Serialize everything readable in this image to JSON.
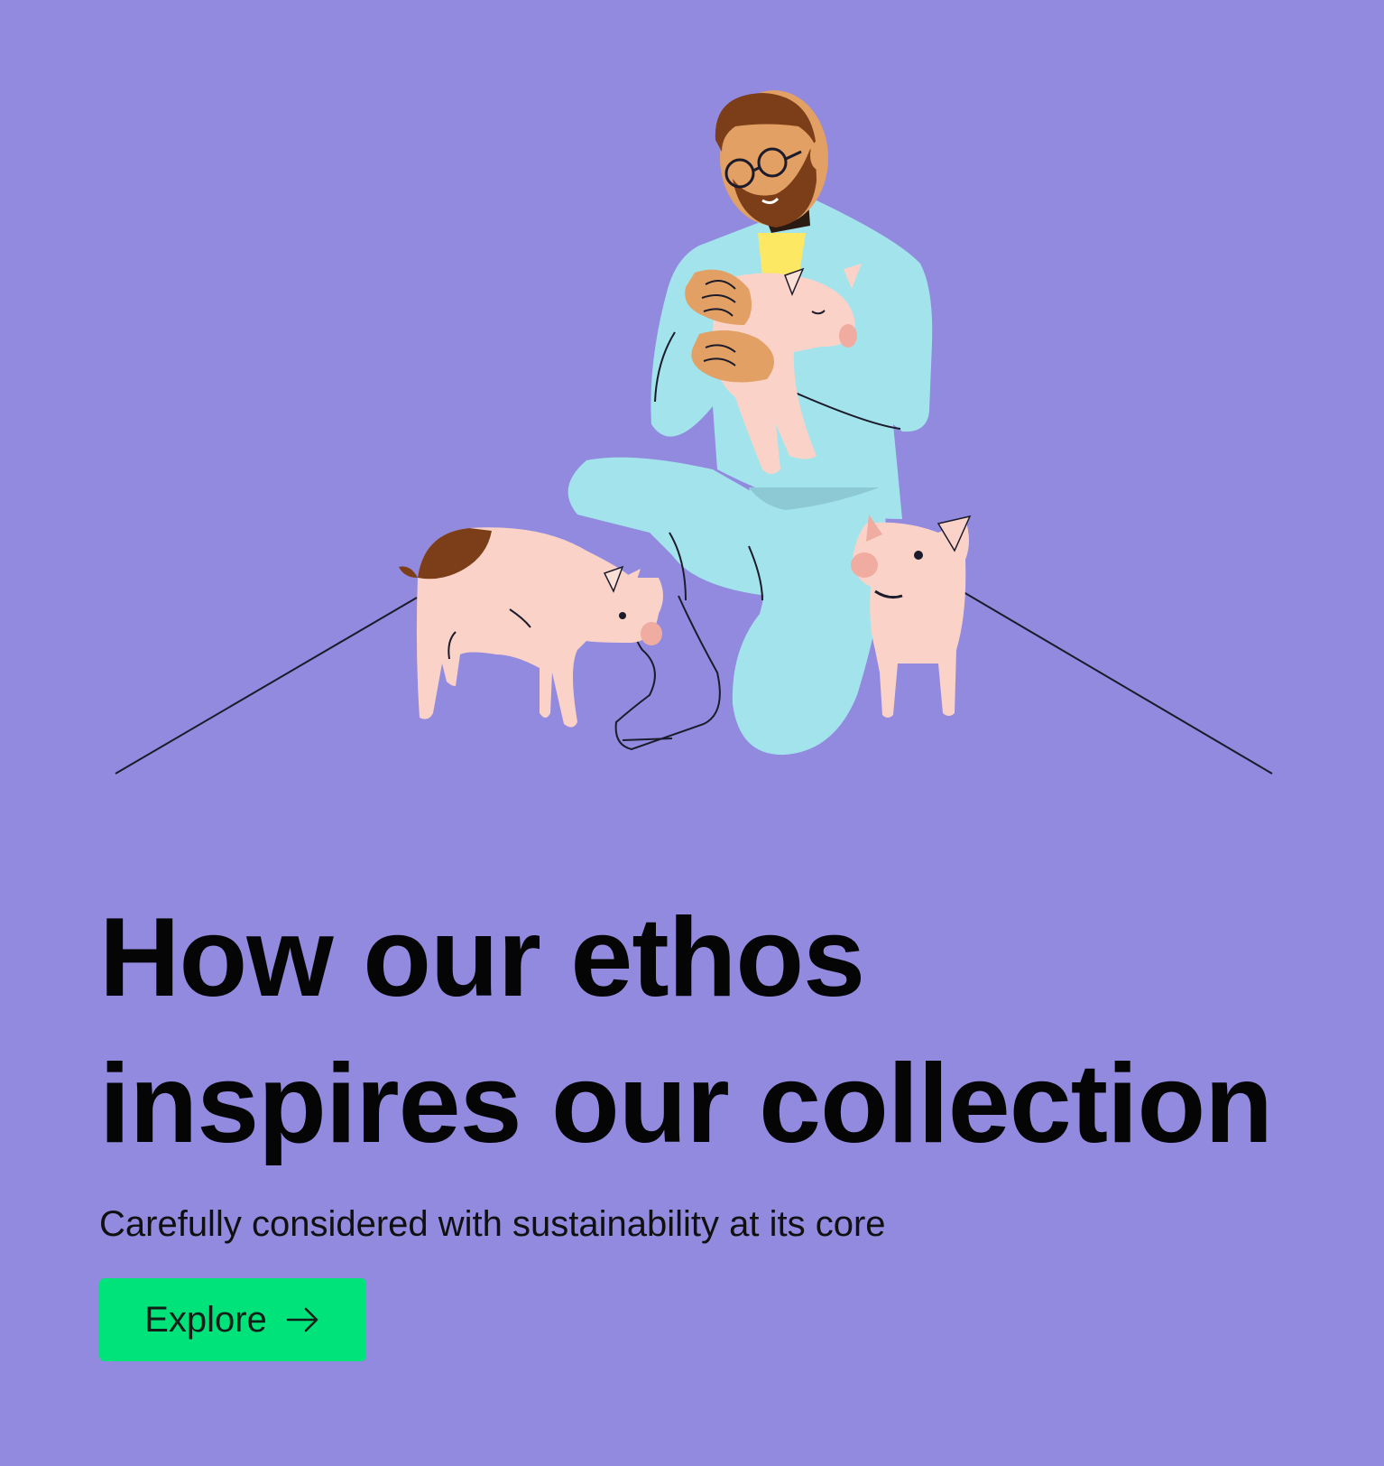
{
  "theme": {
    "background": "#928ade",
    "button_color": "#00e27a",
    "scrubs_color": "#a3e4ec",
    "pig_color": "#fad2c8",
    "shirt_color": "#fce862",
    "hair_color": "#7c3e19",
    "skin_color": "#e2a064"
  },
  "hero": {
    "illustration": "farmer-holding-piglets-illustration",
    "headline_line1": "How our ethos",
    "headline_line2": "inspires our collection",
    "subtitle": "Carefully considered with sustainability at its core",
    "cta_label": "Explore",
    "cta_icon": "arrow-right-icon"
  }
}
